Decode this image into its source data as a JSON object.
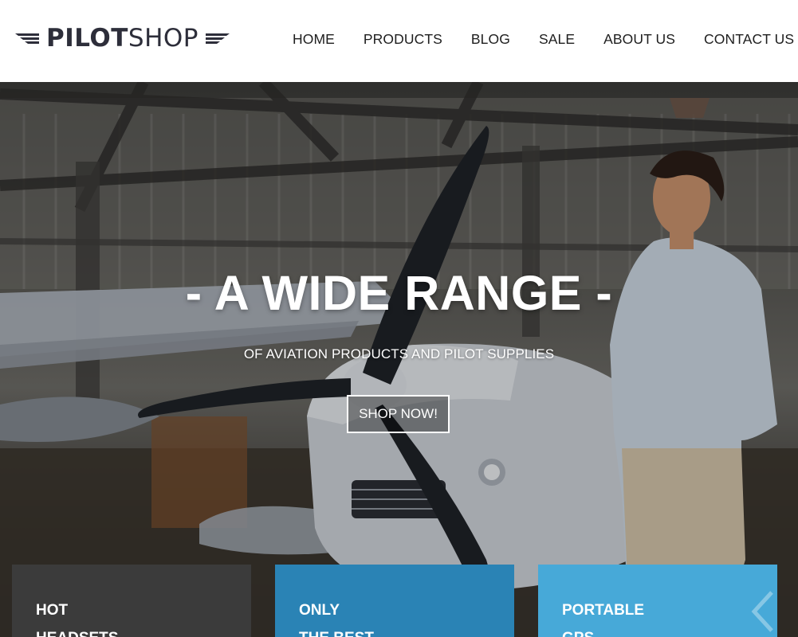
{
  "brand": {
    "logo_bold": "PILOT",
    "logo_light": "SHOP"
  },
  "nav": {
    "items": [
      "HOME",
      "PRODUCTS",
      "BLOG",
      "SALE",
      "ABOUT US",
      "CONTACT US"
    ]
  },
  "hero": {
    "title": "- A WIDE RANGE -",
    "subtitle": "OF AVIATION PRODUCTS AND PILOT SUPPLIES",
    "cta_label": "SHOP NOW!"
  },
  "tiles": [
    {
      "line1": "HOT",
      "line2": "HEADSETS",
      "color": "#3b3b3b"
    },
    {
      "line1": "ONLY",
      "line2": "THE BEST",
      "color": "#2a83b5"
    },
    {
      "line1": "PORTABLE",
      "line2": "GPS",
      "color": "#47a9d8"
    }
  ],
  "slider": {
    "next_icon": "chevron-right-icon"
  }
}
